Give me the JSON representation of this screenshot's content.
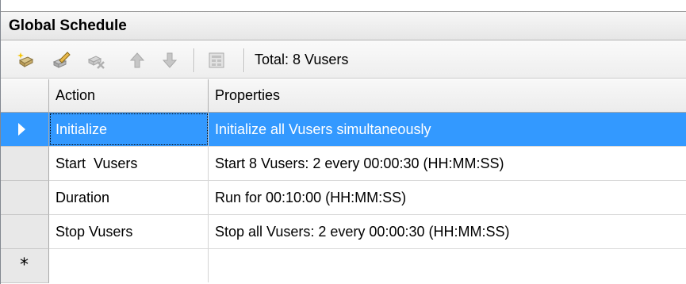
{
  "window": {
    "title": "Global Schedule"
  },
  "toolbar": {
    "icons": [
      "new-action-icon",
      "edit-action-icon",
      "delete-action-icon",
      "move-up-icon",
      "move-down-icon",
      "details-icon"
    ],
    "total_label": "Total: 8 Vusers"
  },
  "grid": {
    "columns": [
      "Action",
      "Properties"
    ],
    "rows": [
      {
        "action": "Initialize",
        "properties": "Initialize all Vusers simultaneously",
        "selected": true
      },
      {
        "action": "Start  Vusers",
        "properties": "Start 8 Vusers: 2 every 00:00:30 (HH:MM:SS)"
      },
      {
        "action": "Duration",
        "properties": "Run for 00:10:00 (HH:MM:SS)"
      },
      {
        "action": "Stop Vusers",
        "properties": "Stop all Vusers: 2 every 00:00:30 (HH:MM:SS)"
      }
    ],
    "new_row_marker": "*"
  },
  "colors": {
    "selection": "#3399ff"
  }
}
